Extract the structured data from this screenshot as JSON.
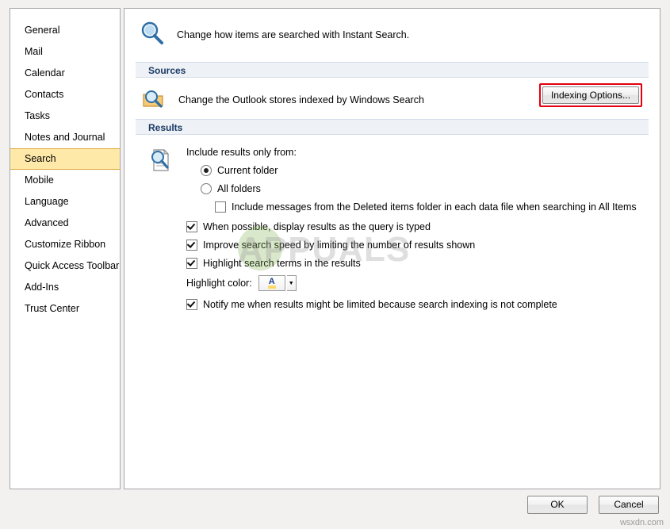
{
  "window": {
    "header_text": "Change how items are searched with Instant Search.",
    "header_icon": "magnifier-icon"
  },
  "sidebar": {
    "items": [
      {
        "label": "General",
        "selected": false
      },
      {
        "label": "Mail",
        "selected": false
      },
      {
        "label": "Calendar",
        "selected": false
      },
      {
        "label": "Contacts",
        "selected": false
      },
      {
        "label": "Tasks",
        "selected": false
      },
      {
        "label": "Notes and Journal",
        "selected": false
      },
      {
        "label": "Search",
        "selected": true
      },
      {
        "label": "Mobile",
        "selected": false
      },
      {
        "label": "Language",
        "selected": false
      },
      {
        "label": "Advanced",
        "selected": false
      },
      {
        "label": "Customize Ribbon",
        "selected": false
      },
      {
        "label": "Quick Access Toolbar",
        "selected": false
      },
      {
        "label": "Add-Ins",
        "selected": false
      },
      {
        "label": "Trust Center",
        "selected": false
      }
    ]
  },
  "sources": {
    "section_title": "Sources",
    "description": "Change the Outlook stores indexed by Windows Search",
    "button_label": "Indexing Options...",
    "highlight_color": "#e4000f",
    "icon": "magnifier-folder-icon"
  },
  "results": {
    "section_title": "Results",
    "icon": "magnifier-document-icon",
    "include_label": "Include results only from:",
    "radios": [
      {
        "label": "Current folder",
        "checked": true,
        "underline_index": 8
      },
      {
        "label": "All folders",
        "checked": false
      }
    ],
    "deleted_items_checkbox": {
      "label": "Include messages from the Deleted items folder in each data file when searching in All Items",
      "checked": false
    },
    "checkboxes": [
      {
        "label": "When possible, display results as the query is typed",
        "checked": true
      },
      {
        "label": "Improve search speed by limiting the number of results shown",
        "checked": true
      },
      {
        "label": "Highlight search terms in the results",
        "checked": true
      }
    ],
    "highlight_color_label": "Highlight color:",
    "highlight_color_swatch": "#ffd966",
    "notify_checkbox": {
      "label": "Notify me when results might be limited because search indexing is not complete",
      "checked": true
    }
  },
  "footer": {
    "ok_label": "OK",
    "cancel_label": "Cancel"
  },
  "watermark": {
    "text": "APPUALS",
    "url": "wsxdn.com"
  }
}
